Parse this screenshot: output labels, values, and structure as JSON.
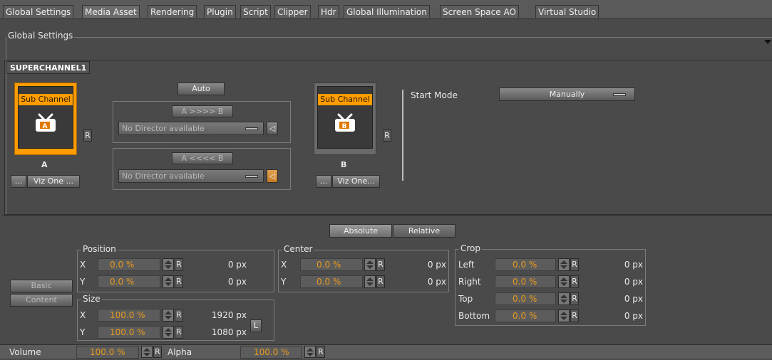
{
  "tabs": [
    "Global Settings",
    "Media Asset",
    "Rendering",
    "Plugin",
    "Script",
    "Clipper",
    "Hdr",
    "Global Illumination",
    "Screen Space AO",
    "Virtual Studio"
  ],
  "section_title": "Global Settings",
  "superchannel_tab": "SUPERCHANNEL1",
  "auto_label": "Auto",
  "sub_channel_label": "Sub Channel",
  "channel_a": {
    "letter": "A",
    "icon_letter": "A",
    "r": "R",
    "dots": "...",
    "vizone": "Viz One ..."
  },
  "channel_b": {
    "letter": "B",
    "icon_letter": "B",
    "r": "R",
    "dots": "...",
    "vizone": "Viz One..."
  },
  "transition_ab": {
    "label": "A >>>> B",
    "director": "No Director available"
  },
  "transition_ba": {
    "label": "A <<<< B",
    "director": "No Director available"
  },
  "start_mode": {
    "label": "Start Mode",
    "value": "Manually"
  },
  "mode_buttons": {
    "absolute": "Absolute",
    "relative": "Relative"
  },
  "side_tabs": {
    "basic": "Basic",
    "content": "Content"
  },
  "position": {
    "title": "Position",
    "x_label": "X",
    "x_value": "0.0 %",
    "x_px": "0 px",
    "y_label": "Y",
    "y_value": "0.0 %",
    "y_px": "0 px"
  },
  "size": {
    "title": "Size",
    "x_label": "X",
    "x_value": "100.0 %",
    "x_px": "1920 px",
    "y_label": "Y",
    "y_value": "100.0 %",
    "y_px": "1080 px",
    "lock": "L"
  },
  "center": {
    "title": "Center",
    "x_label": "X",
    "x_value": "0.0 %",
    "x_px": "0 px",
    "y_label": "Y",
    "y_value": "0.0 %",
    "y_px": "0 px"
  },
  "crop": {
    "title": "Crop",
    "rows": [
      {
        "label": "Left",
        "value": "0.0 %",
        "px": "0 px"
      },
      {
        "label": "Right",
        "value": "0.0 %",
        "px": "0 px"
      },
      {
        "label": "Top",
        "value": "0.0 %",
        "px": "0 px"
      },
      {
        "label": "Bottom",
        "value": "0.0 %",
        "px": "0 px"
      }
    ]
  },
  "r_label": "R",
  "volume": {
    "label": "Volume",
    "value": "100.0 %"
  },
  "alpha": {
    "label": "Alpha",
    "value": "100.0 %"
  }
}
